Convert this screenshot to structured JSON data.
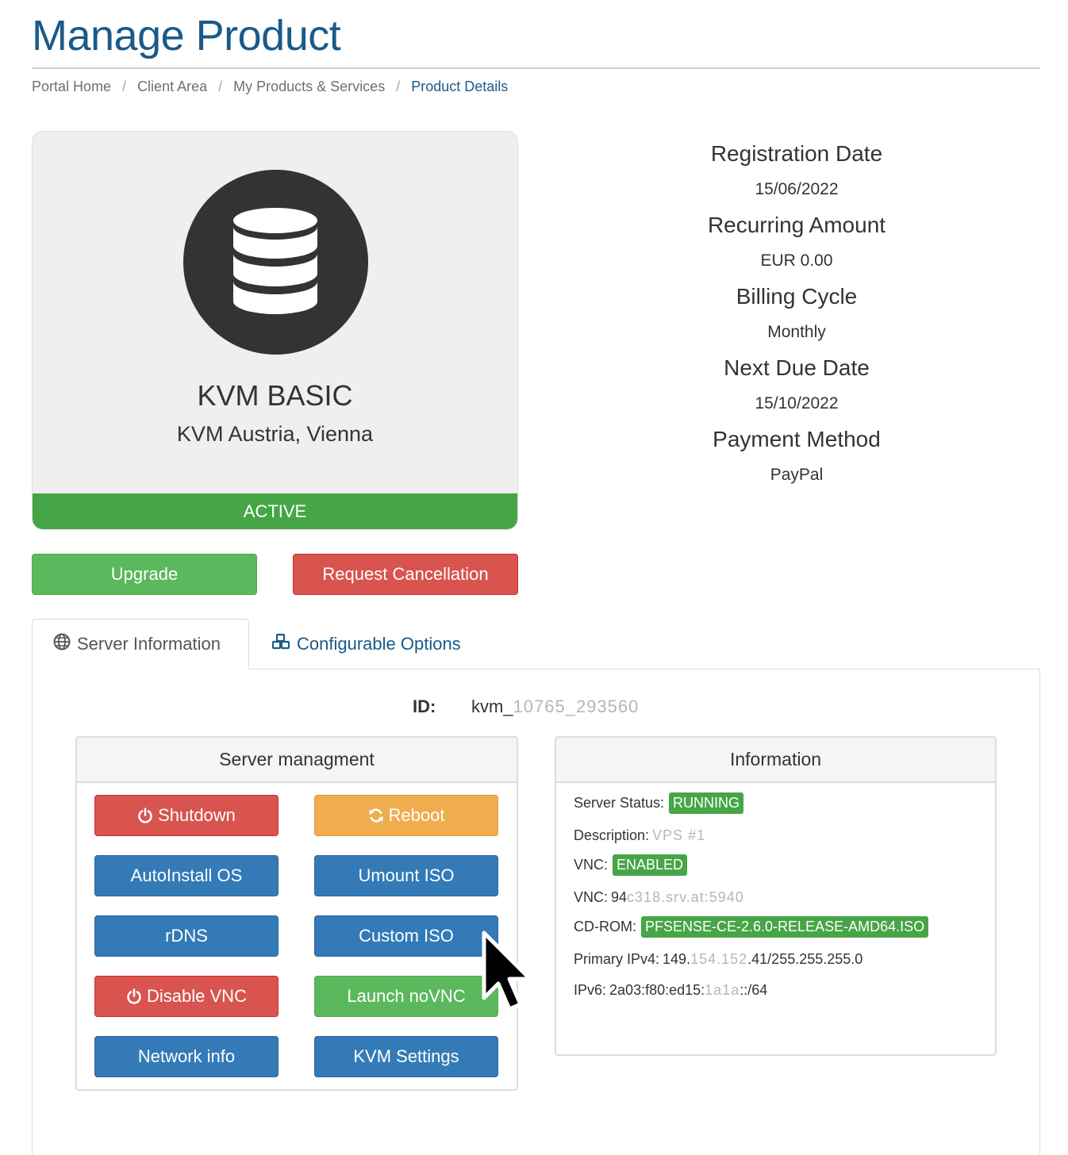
{
  "page": {
    "title": "Manage Product"
  },
  "breadcrumb": [
    {
      "label": "Portal Home"
    },
    {
      "label": "Client Area"
    },
    {
      "label": "My Products & Services"
    },
    {
      "label": "Product Details"
    }
  ],
  "product": {
    "icon": "database-icon",
    "name": "KVM BASIC",
    "location": "KVM Austria, Vienna",
    "status": "ACTIVE",
    "status_color": "#46a546"
  },
  "actions": {
    "upgrade": "Upgrade",
    "cancel": "Request Cancellation"
  },
  "details": {
    "registration_label": "Registration Date",
    "registration_value": "15/06/2022",
    "recurring_label": "Recurring Amount",
    "recurring_value": "EUR 0.00",
    "billing_label": "Billing Cycle",
    "billing_value": "Monthly",
    "nextdue_label": "Next Due Date",
    "nextdue_value": "15/10/2022",
    "payment_label": "Payment Method",
    "payment_value": "PayPal"
  },
  "tabs": [
    {
      "label": "Server Information",
      "icon": "globe-icon",
      "active": true
    },
    {
      "label": "Configurable Options",
      "icon": "cubes-icon",
      "active": false
    }
  ],
  "server": {
    "id_label": "ID:",
    "id_prefix": "kvm_",
    "id_masked": "10765_293560"
  },
  "management": {
    "title": "Server managment",
    "buttons": {
      "shutdown": "Shutdown",
      "reboot": "Reboot",
      "autoinstall": "AutoInstall OS",
      "umount": "Umount ISO",
      "rdns": "rDNS",
      "custom_iso": "Custom ISO",
      "disable_vnc": "Disable VNC",
      "launch_novnc": "Launch noVNC",
      "network_info": "Network info",
      "kvm_settings": "KVM Settings"
    }
  },
  "information": {
    "title": "Information",
    "status_label": "Server Status:",
    "status_value": "RUNNING",
    "description_label": "Description:",
    "description_masked": "VPS #1",
    "vnc_label": "VNC:",
    "vnc_value": "ENABLED",
    "vnc2_label": "VNC:",
    "vnc2_prefix": "94",
    "vnc2_masked": "c318.srv.at:5940",
    "cdrom_label": "CD-ROM:",
    "cdrom_value": "PFSENSE-CE-2.6.0-RELEASE-AMD64.ISO",
    "ipv4_label": "Primary IPv4:",
    "ipv4_prefix": "149.",
    "ipv4_masked": "154.152",
    "ipv4_suffix": ".41/255.255.255.0",
    "ipv6_label": "IPv6:",
    "ipv6_prefix": "2a03:f80:ed15:",
    "ipv6_masked": "1a1a",
    "ipv6_suffix": "::/64"
  },
  "colors": {
    "brand": "#1a5a8a",
    "success": "#5cb85c",
    "danger": "#d9534f",
    "warning": "#f0ad4e",
    "primary": "#337ab7"
  }
}
